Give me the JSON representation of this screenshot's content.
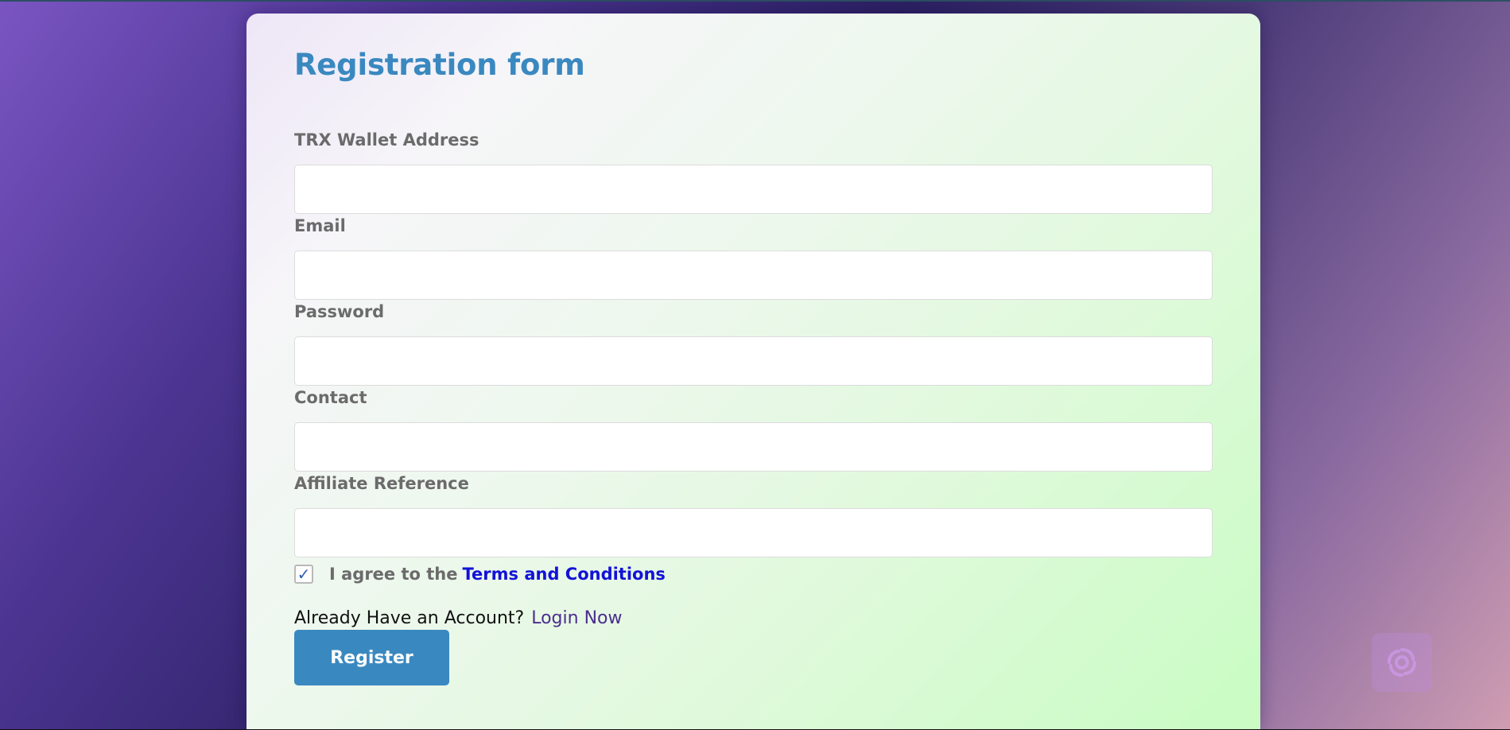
{
  "form": {
    "title": "Registration form",
    "fields": [
      {
        "label": "TRX Wallet Address",
        "value": "",
        "placeholder": ""
      },
      {
        "label": "Email",
        "value": "",
        "placeholder": ""
      },
      {
        "label": "Password",
        "value": "",
        "placeholder": ""
      },
      {
        "label": "Contact",
        "value": "",
        "placeholder": ""
      },
      {
        "label": "Affiliate Reference",
        "value": "",
        "placeholder": ""
      }
    ],
    "agree": {
      "checked": true,
      "text": "I agree to the",
      "link_text": "Terms and Conditions"
    },
    "account": {
      "text": "Already Have an Account?",
      "link_text": "Login Now"
    },
    "register_label": "Register"
  },
  "widget": {
    "icon": "chatbot-icon"
  },
  "colors": {
    "accent": "#3a88c0",
    "label": "#6b6b6b",
    "terms_link": "#1212d8",
    "login_link": "#4b2e8e"
  }
}
